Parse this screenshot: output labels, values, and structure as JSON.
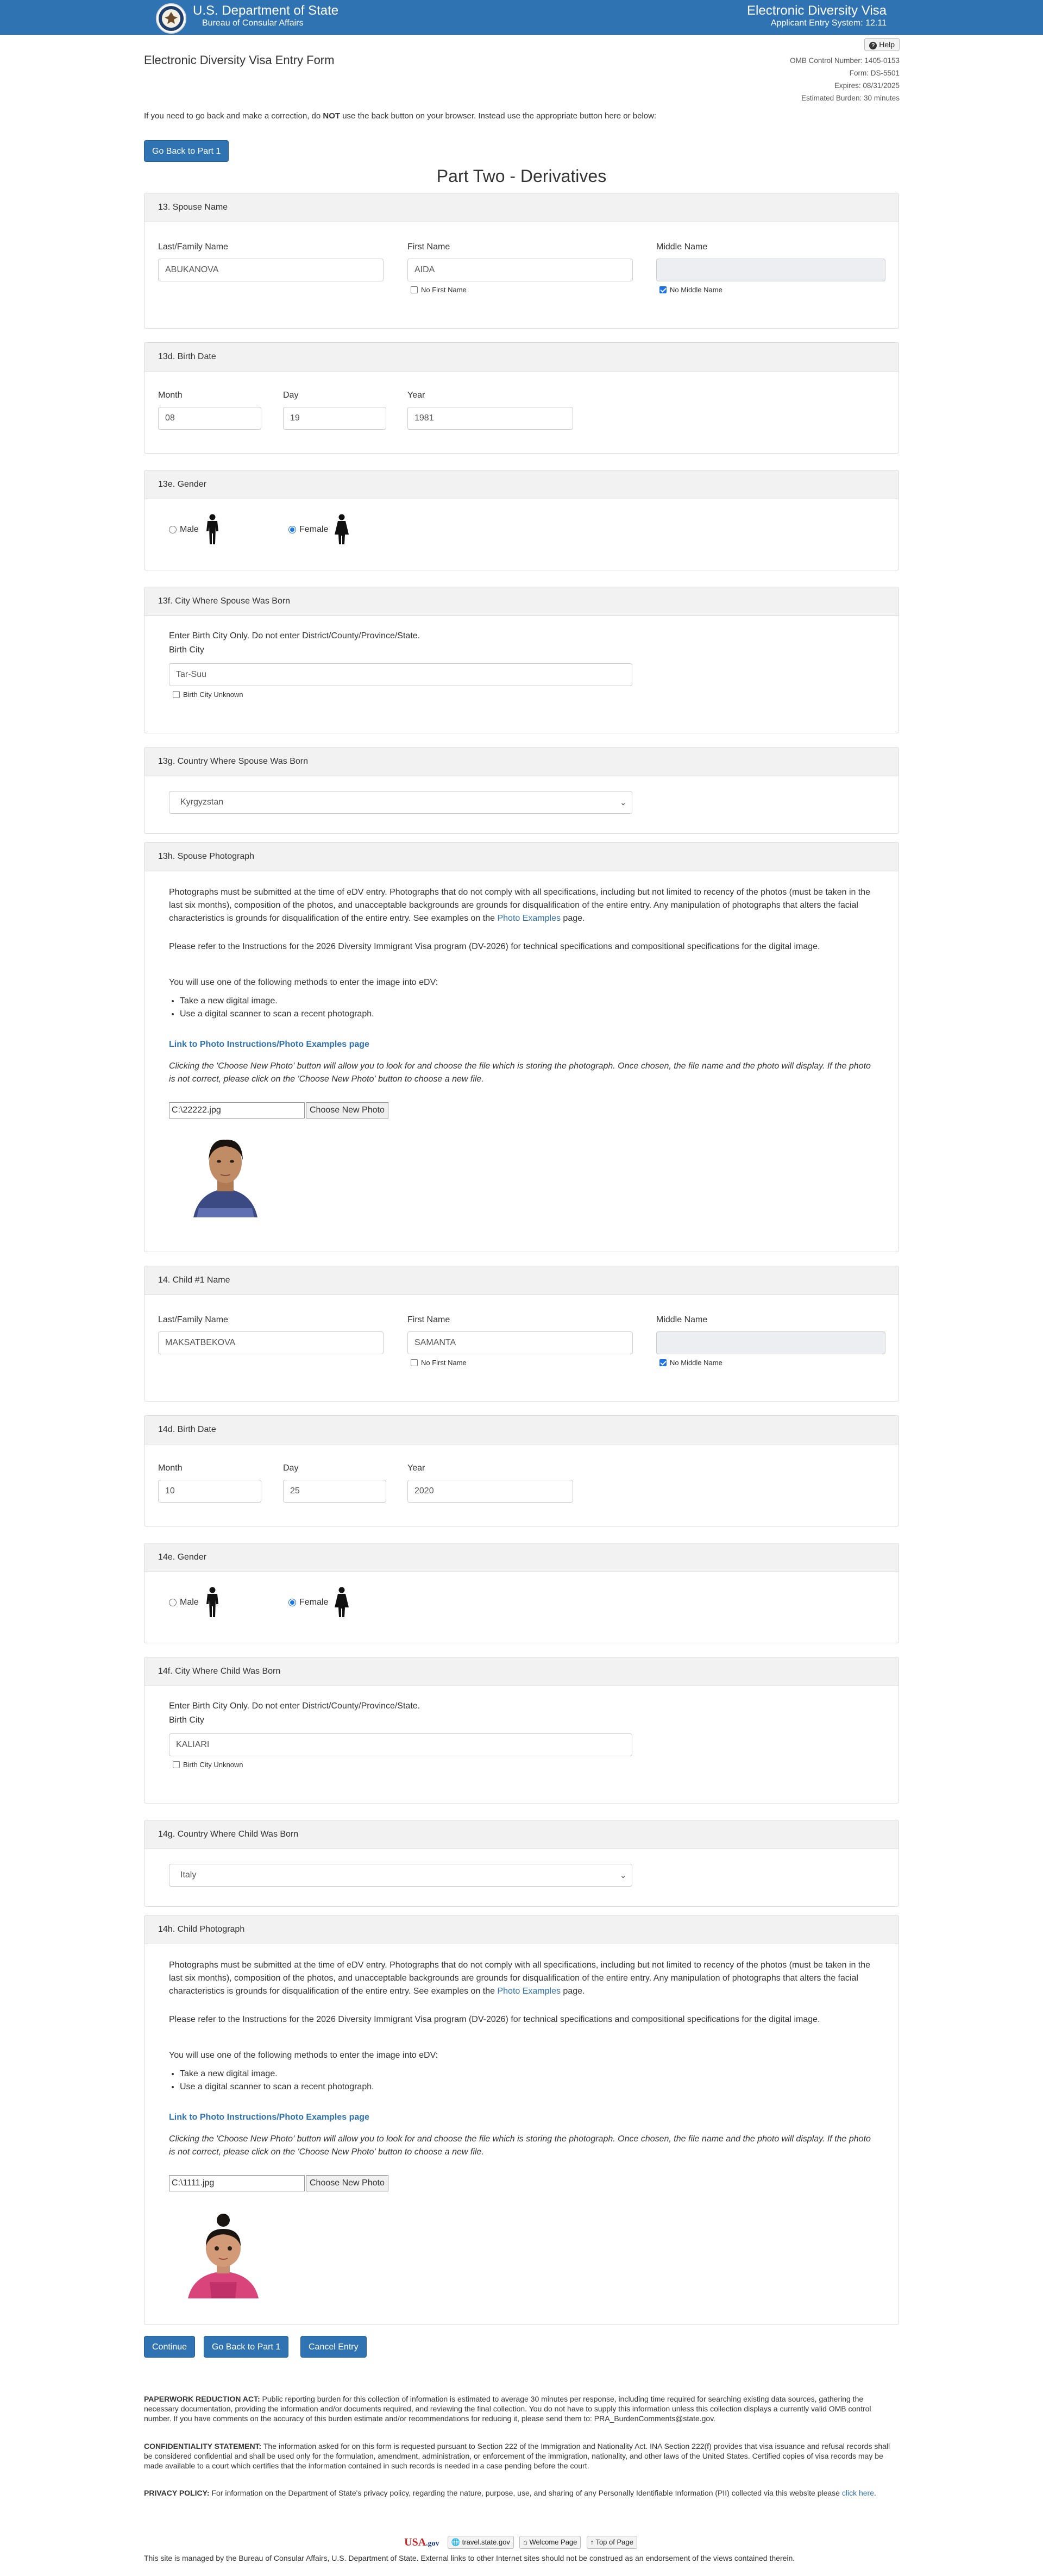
{
  "header": {
    "dept_title": "U.S. Department of State",
    "dept_sub": "Bureau of Consular Affairs",
    "app_title": "Electronic Diversity Visa",
    "app_sub": "Applicant Entry System: 12.11",
    "help_label": "Help"
  },
  "form_title": "Electronic Diversity Visa Entry Form",
  "omb": {
    "control": "OMB Control Number: 1405-0153",
    "form": "Form: DS-5501",
    "expires": "Expires: 08/31/2025",
    "burden": "Estimated Burden: 30 minutes"
  },
  "instructions": {
    "pre": "If you need to go back and make a correction, do ",
    "bold": "NOT",
    "post": " use the back button on your browser. Instead use the appropriate button here or below:"
  },
  "go_back_label": "Go Back to Part 1",
  "part_title": "Part Two - Derivatives",
  "spouse": {
    "name_heading": "13. Spouse Name",
    "last_label": "Last/Family Name",
    "last_value": "ABUKANOVA",
    "first_label": "First Name",
    "first_value": "AIDA",
    "no_first_label": "No First Name",
    "middle_label": "Middle Name",
    "middle_value": "",
    "no_middle_label": "No Middle Name",
    "birth_heading": "13d. Birth Date",
    "month_label": "Month",
    "month_value": "08",
    "day_label": "Day",
    "day_value": "19",
    "year_label": "Year",
    "year_value": "1981",
    "gender_heading": "13e. Gender",
    "male_label": "Male",
    "female_label": "Female",
    "gender_selected": "Female",
    "city_heading": "13f. City Where Spouse Was Born",
    "city_note": "Enter Birth City Only. Do not enter District/County/Province/State.",
    "city_label": "Birth City",
    "city_value": "Tar-Suu",
    "city_unknown_label": "Birth City Unknown",
    "country_heading": "13g. Country Where Spouse Was Born",
    "country_value": "Kyrgyzstan",
    "photo_heading": "13h. Spouse Photograph",
    "file_value": "C:\\22222.jpg"
  },
  "child": {
    "name_heading": "14. Child #1 Name",
    "last_label": "Last/Family Name",
    "last_value": "MAKSATBEKOVA",
    "first_label": "First Name",
    "first_value": "SAMANTA",
    "no_first_label": "No First Name",
    "middle_label": "Middle Name",
    "middle_value": "",
    "no_middle_label": "No Middle Name",
    "birth_heading": "14d. Birth Date",
    "month_label": "Month",
    "month_value": "10",
    "day_label": "Day",
    "day_value": "25",
    "year_label": "Year",
    "year_value": "2020",
    "gender_heading": "14e. Gender",
    "male_label": "Male",
    "female_label": "Female",
    "gender_selected": "Female",
    "city_heading": "14f. City Where Child Was Born",
    "city_note": "Enter Birth City Only. Do not enter District/County/Province/State.",
    "city_label": "Birth City",
    "city_value": "KALIARI",
    "city_unknown_label": "Birth City Unknown",
    "country_heading": "14g. Country Where Child Was Born",
    "country_value": "Italy",
    "photo_heading": "14h. Child Photograph",
    "file_value": "C:\\1111.jpg"
  },
  "photo_text": {
    "p1_pre": "Photographs must be submitted at the time of eDV entry. Photographs that do not comply with all specifications, including but not limited to recency of the photos (must be taken in the last six months), composition of the photos, and unacceptable backgrounds are grounds for disqualification of the entire entry. Any manipulation of photographs that alters the facial characteristics is grounds for disqualification of the entire entry. See examples on the ",
    "p1_link": "Photo Examples",
    "p1_post": " page.",
    "p2": "Please refer to the Instructions for the 2026 Diversity Immigrant Visa program (DV-2026) for technical specifications and compositional specifications for the digital image.",
    "p3": "You will use one of the following methods to enter the image into eDV:",
    "li1": "Take a new digital image.",
    "li2": "Use a digital scanner to scan a recent photograph.",
    "link": "Link to Photo Instructions/Photo Examples page",
    "italic": "Clicking the 'Choose New Photo' button will allow you to look for and choose the file which is storing the photograph. Once chosen, the file name and the photo will display. If the photo is not correct, please click on the 'Choose New Photo' button to choose a new file.",
    "choose_label": "Choose New Photo"
  },
  "actions": {
    "continue": "Continue",
    "go_back": "Go Back to Part 1",
    "cancel": "Cancel Entry"
  },
  "footer": {
    "prb_title": "PAPERWORK REDUCTION ACT:",
    "prb_text": " Public reporting burden for this collection of information is estimated to average 30 minutes per response, including time required for searching existing data sources, gathering the necessary documentation, providing the information and/or documents required, and reviewing the final collection. You do not have to supply this information unless this collection displays a currently valid OMB control number. If you have comments on the accuracy of this burden estimate and/or recommendations for reducing it, please send them to: PRA_BurdenComments@state.gov.",
    "conf_title": "CONFIDENTIALITY STATEMENT:",
    "conf_text": " The information asked for on this form is requested pursuant to Section 222 of the Immigration and Nationality Act. INA Section 222(f) provides that visa issuance and refusal records shall be considered confidential and shall be used only for the formulation, amendment, administration, or enforcement of the immigration, nationality, and other laws of the United States. Certified copies of visa records may be made available to a court which certifies that the information contained in such records is needed in a case pending before the court.",
    "privacy_title": "PRIVACY POLICY:",
    "privacy_text": " For information on the Department of State's privacy policy, regarding the nature, purpose, use, and sharing of any Personally Identifiable Information (PII) collected via this website please ",
    "privacy_link": "click here",
    "privacy_end": ".",
    "usagov": "USA",
    "usagov_suffix": ".gov",
    "travel": "travel.state.gov",
    "welcome": "Welcome Page",
    "top": "Top of Page",
    "managed": "This site is managed by the Bureau of Consular Affairs, U.S. Department of State. External links to other Internet sites should not be construed as an endorsement of the views contained therein."
  },
  "colors": {
    "brand_blue": "#2f73b2",
    "panel_header": "#f2f2f2",
    "link_blue": "#2f73b2"
  }
}
